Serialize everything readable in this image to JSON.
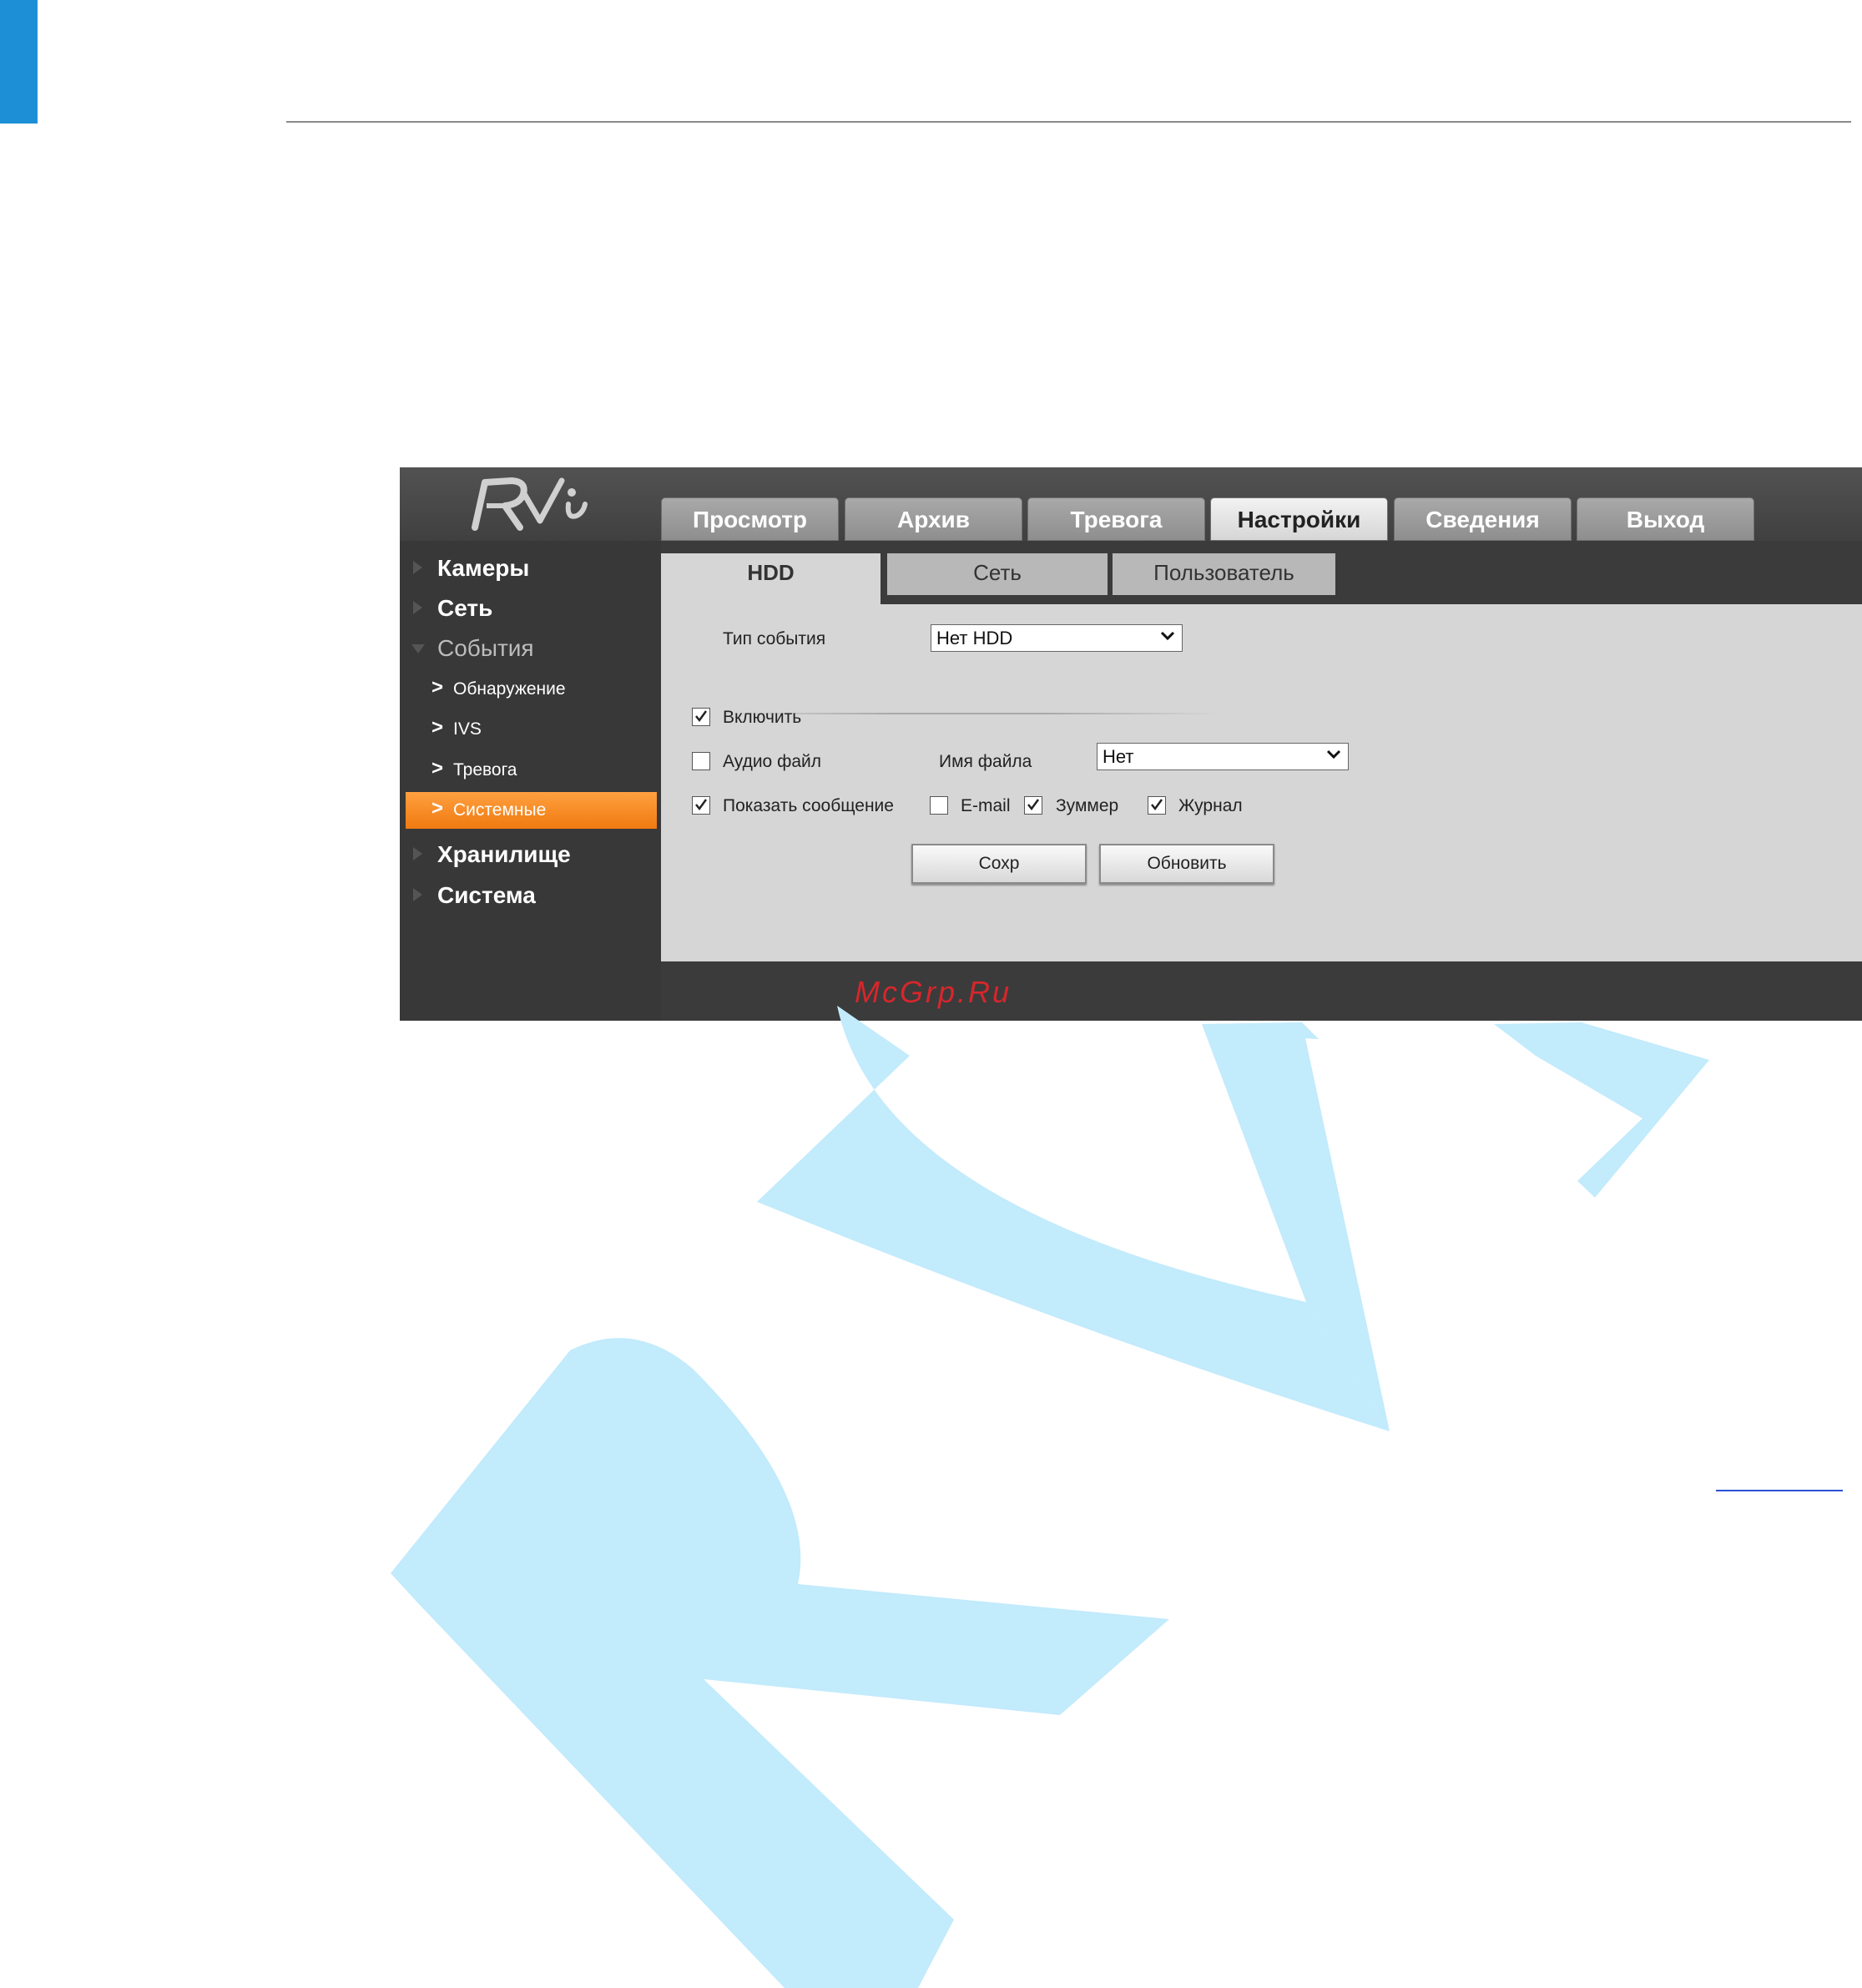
{
  "logo": {
    "text": "RVi"
  },
  "main_tabs": [
    "Просмотр",
    "Архив",
    "Тревога",
    "Настройки",
    "Сведения",
    "Выход"
  ],
  "main_tab_active": "Настройки",
  "sidebar": {
    "items": [
      "Камеры",
      "Сеть",
      "События"
    ],
    "subitems": [
      "Обнаружение",
      "IVS",
      "Тревога",
      "Системные"
    ],
    "after_items": [
      "Хранилище",
      "Система"
    ],
    "active": "Системные"
  },
  "sub_tabs": [
    "HDD",
    "Сеть",
    "Пользователь"
  ],
  "sub_tab_active": "HDD",
  "form": {
    "event_type_label": "Тип события",
    "event_type_value": "Нет HDD",
    "enable_label": "Включить",
    "audio_label": "Аудио файл",
    "filename_label": "Имя файла",
    "filename_value": "Нет",
    "show_message_label": "Показать сообщение",
    "email_label": "E-mail",
    "buzzer_label": "Зуммер",
    "log_label": "Журнал",
    "checks": {
      "enable": true,
      "audio": false,
      "show_message": true,
      "email": false,
      "buzzer": true,
      "log": true
    }
  },
  "buttons": {
    "save": "Сохр",
    "refresh": "Обновить"
  },
  "footer": {
    "watermark_text": "McGrp.Ru"
  },
  "colors": {
    "accent_blue": "#1d8fd6",
    "active_orange": "#f58a20",
    "watermark_cyan": "#c2ebfc",
    "footer_red": "#d7262c"
  }
}
